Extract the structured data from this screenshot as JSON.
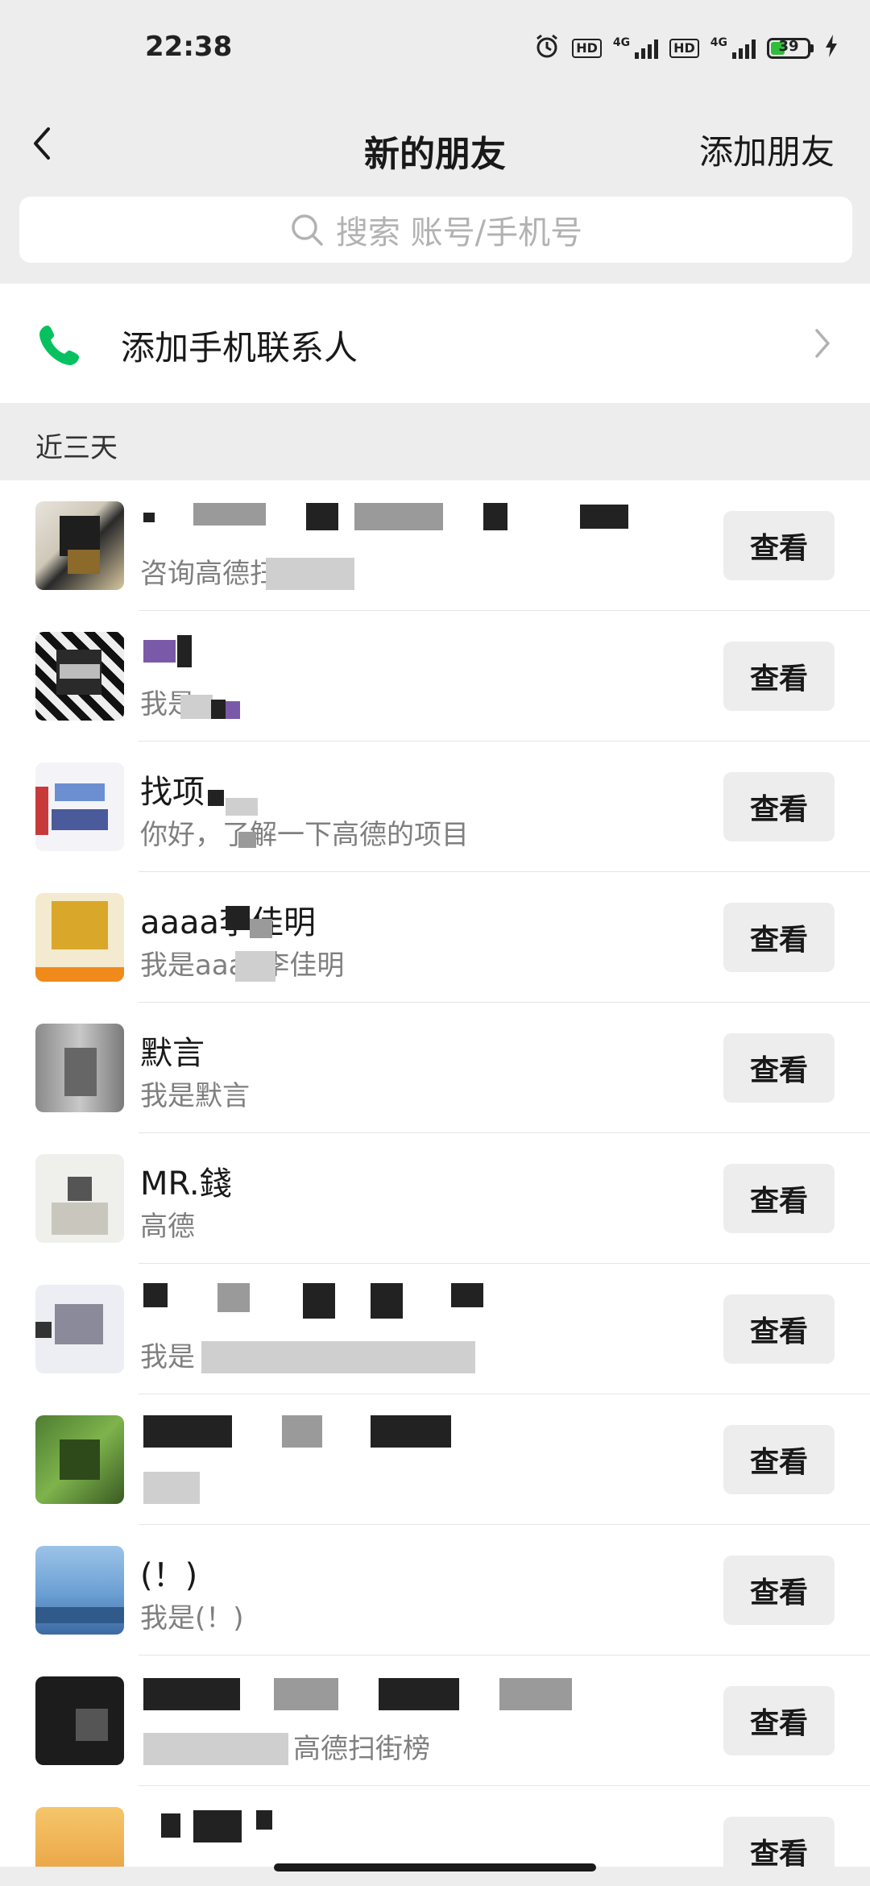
{
  "status_bar": {
    "time": "22:38",
    "hd1": "HD",
    "net1": "4G",
    "hd2": "HD",
    "net2": "4G",
    "battery": "39",
    "battery_level": 0.39
  },
  "nav": {
    "title": "新的朋友",
    "action": "添加朋友"
  },
  "search": {
    "placeholder": "搜索 账号/手机号"
  },
  "add_contacts": {
    "label": "添加手机联系人"
  },
  "section": {
    "label": "近三天"
  },
  "view_label": "查看",
  "requests": [
    {
      "name": "",
      "message": "咨询高德扫"
    },
    {
      "name": "",
      "message": "我是"
    },
    {
      "name": "找项",
      "message": "你好，了解一下高德的项目"
    },
    {
      "name": "aaaa李佳明",
      "message": "我是aaaa李佳明"
    },
    {
      "name": "默言",
      "message": "我是默言"
    },
    {
      "name": "MR.錢",
      "message": "高德"
    },
    {
      "name": "",
      "message": "我是"
    },
    {
      "name": "",
      "message": ""
    },
    {
      "name": "(！)",
      "message": "我是(！)"
    },
    {
      "name": "",
      "message": "高德扫街榜"
    },
    {
      "name": "",
      "message": ""
    }
  ],
  "colors": {
    "background": "#ededed",
    "phone_icon": "#07c160",
    "battery_fill": "#2fbd3c"
  }
}
